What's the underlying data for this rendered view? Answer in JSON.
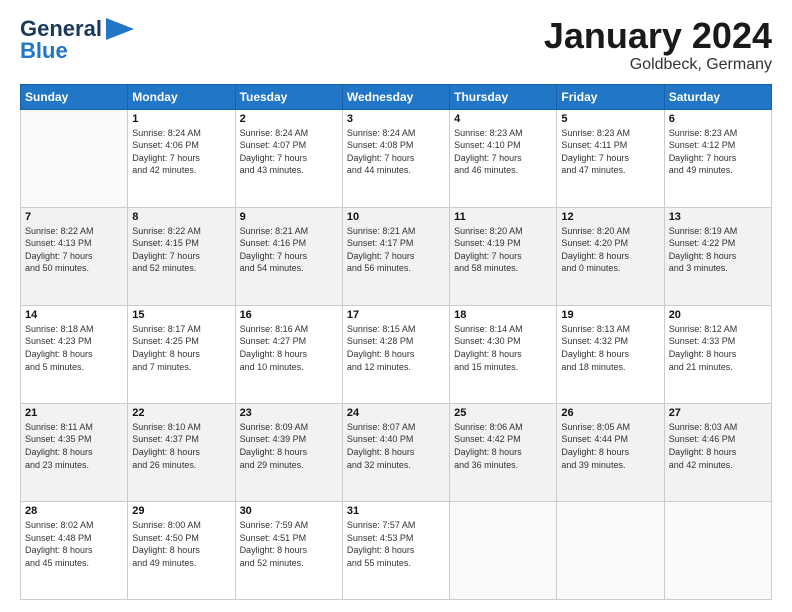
{
  "logo": {
    "line1": "General",
    "line2": "Blue",
    "icon": "▶"
  },
  "title": "January 2024",
  "location": "Goldbeck, Germany",
  "headers": [
    "Sunday",
    "Monday",
    "Tuesday",
    "Wednesday",
    "Thursday",
    "Friday",
    "Saturday"
  ],
  "weeks": [
    [
      {
        "day": "",
        "info": ""
      },
      {
        "day": "1",
        "info": "Sunrise: 8:24 AM\nSunset: 4:06 PM\nDaylight: 7 hours\nand 42 minutes."
      },
      {
        "day": "2",
        "info": "Sunrise: 8:24 AM\nSunset: 4:07 PM\nDaylight: 7 hours\nand 43 minutes."
      },
      {
        "day": "3",
        "info": "Sunrise: 8:24 AM\nSunset: 4:08 PM\nDaylight: 7 hours\nand 44 minutes."
      },
      {
        "day": "4",
        "info": "Sunrise: 8:23 AM\nSunset: 4:10 PM\nDaylight: 7 hours\nand 46 minutes."
      },
      {
        "day": "5",
        "info": "Sunrise: 8:23 AM\nSunset: 4:11 PM\nDaylight: 7 hours\nand 47 minutes."
      },
      {
        "day": "6",
        "info": "Sunrise: 8:23 AM\nSunset: 4:12 PM\nDaylight: 7 hours\nand 49 minutes."
      }
    ],
    [
      {
        "day": "7",
        "info": "Sunrise: 8:22 AM\nSunset: 4:13 PM\nDaylight: 7 hours\nand 50 minutes."
      },
      {
        "day": "8",
        "info": "Sunrise: 8:22 AM\nSunset: 4:15 PM\nDaylight: 7 hours\nand 52 minutes."
      },
      {
        "day": "9",
        "info": "Sunrise: 8:21 AM\nSunset: 4:16 PM\nDaylight: 7 hours\nand 54 minutes."
      },
      {
        "day": "10",
        "info": "Sunrise: 8:21 AM\nSunset: 4:17 PM\nDaylight: 7 hours\nand 56 minutes."
      },
      {
        "day": "11",
        "info": "Sunrise: 8:20 AM\nSunset: 4:19 PM\nDaylight: 7 hours\nand 58 minutes."
      },
      {
        "day": "12",
        "info": "Sunrise: 8:20 AM\nSunset: 4:20 PM\nDaylight: 8 hours\nand 0 minutes."
      },
      {
        "day": "13",
        "info": "Sunrise: 8:19 AM\nSunset: 4:22 PM\nDaylight: 8 hours\nand 3 minutes."
      }
    ],
    [
      {
        "day": "14",
        "info": "Sunrise: 8:18 AM\nSunset: 4:23 PM\nDaylight: 8 hours\nand 5 minutes."
      },
      {
        "day": "15",
        "info": "Sunrise: 8:17 AM\nSunset: 4:25 PM\nDaylight: 8 hours\nand 7 minutes."
      },
      {
        "day": "16",
        "info": "Sunrise: 8:16 AM\nSunset: 4:27 PM\nDaylight: 8 hours\nand 10 minutes."
      },
      {
        "day": "17",
        "info": "Sunrise: 8:15 AM\nSunset: 4:28 PM\nDaylight: 8 hours\nand 12 minutes."
      },
      {
        "day": "18",
        "info": "Sunrise: 8:14 AM\nSunset: 4:30 PM\nDaylight: 8 hours\nand 15 minutes."
      },
      {
        "day": "19",
        "info": "Sunrise: 8:13 AM\nSunset: 4:32 PM\nDaylight: 8 hours\nand 18 minutes."
      },
      {
        "day": "20",
        "info": "Sunrise: 8:12 AM\nSunset: 4:33 PM\nDaylight: 8 hours\nand 21 minutes."
      }
    ],
    [
      {
        "day": "21",
        "info": "Sunrise: 8:11 AM\nSunset: 4:35 PM\nDaylight: 8 hours\nand 23 minutes."
      },
      {
        "day": "22",
        "info": "Sunrise: 8:10 AM\nSunset: 4:37 PM\nDaylight: 8 hours\nand 26 minutes."
      },
      {
        "day": "23",
        "info": "Sunrise: 8:09 AM\nSunset: 4:39 PM\nDaylight: 8 hours\nand 29 minutes."
      },
      {
        "day": "24",
        "info": "Sunrise: 8:07 AM\nSunset: 4:40 PM\nDaylight: 8 hours\nand 32 minutes."
      },
      {
        "day": "25",
        "info": "Sunrise: 8:06 AM\nSunset: 4:42 PM\nDaylight: 8 hours\nand 36 minutes."
      },
      {
        "day": "26",
        "info": "Sunrise: 8:05 AM\nSunset: 4:44 PM\nDaylight: 8 hours\nand 39 minutes."
      },
      {
        "day": "27",
        "info": "Sunrise: 8:03 AM\nSunset: 4:46 PM\nDaylight: 8 hours\nand 42 minutes."
      }
    ],
    [
      {
        "day": "28",
        "info": "Sunrise: 8:02 AM\nSunset: 4:48 PM\nDaylight: 8 hours\nand 45 minutes."
      },
      {
        "day": "29",
        "info": "Sunrise: 8:00 AM\nSunset: 4:50 PM\nDaylight: 8 hours\nand 49 minutes."
      },
      {
        "day": "30",
        "info": "Sunrise: 7:59 AM\nSunset: 4:51 PM\nDaylight: 8 hours\nand 52 minutes."
      },
      {
        "day": "31",
        "info": "Sunrise: 7:57 AM\nSunset: 4:53 PM\nDaylight: 8 hours\nand 55 minutes."
      },
      {
        "day": "",
        "info": ""
      },
      {
        "day": "",
        "info": ""
      },
      {
        "day": "",
        "info": ""
      }
    ]
  ]
}
